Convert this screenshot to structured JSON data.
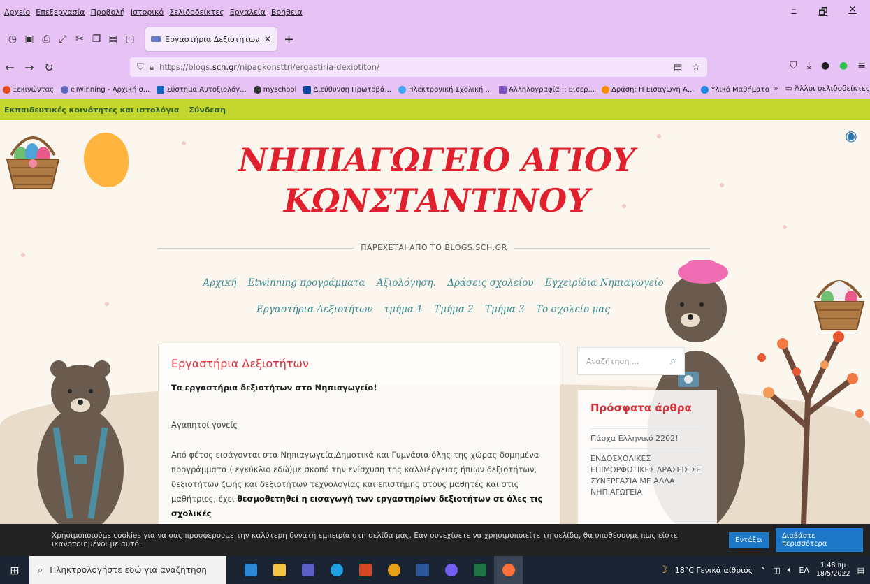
{
  "menu": [
    "Αρχείο",
    "Επεξεργασία",
    "Προβολή",
    "Ιστορικό",
    "Σελιδοδείκτες",
    "Εργαλεία",
    "Βοήθεια"
  ],
  "window_controls": {
    "minimize": "–",
    "restore": "🗗",
    "close": "✕"
  },
  "tab": {
    "title": "Εργαστήρια Δεξιοτήτων | ΝΗΠ",
    "close": "✕",
    "new_tab": "+"
  },
  "url": {
    "prefix": "https://blogs.",
    "host": "sch.gr",
    "path": "/nipagkonsttri/ergastiria-dexiotiton/"
  },
  "bookmarks": [
    {
      "label": "Ξεκινώντας",
      "color": "#e8491d"
    },
    {
      "label": "eTwinning - Αρχική σ...",
      "color": "#5c6bc0"
    },
    {
      "label": "Σύστημα Αυτοξιολόγ...",
      "color": "#1565c0"
    },
    {
      "label": "myschool",
      "color": "#333333"
    },
    {
      "label": "Διεύθυνση Πρωτοβά...",
      "color": "#0d47a1"
    },
    {
      "label": "Ηλεκτρονική Σχολική ...",
      "color": "#42a5f5"
    },
    {
      "label": "Αλληλογραφία :: Εισερ...",
      "color": "#7e57c2"
    },
    {
      "label": "Δράση: Η Εισαγωγή Α...",
      "color": "#fb8c00"
    },
    {
      "label": "Υλικό Μαθήματος | C...",
      "color": "#1e88e5"
    }
  ],
  "bookmarks_more": "»",
  "bookmarks_other": "Άλλοι σελιδοδείκτες",
  "adminbar": [
    "Εκπαιδευτικές κοινότητες και ιστολόγια",
    "Σύνδεση"
  ],
  "site": {
    "title_line1": "ΝΗΠΙΑΓΩΓΕΙΟ ΑΓΙΟΥ",
    "title_line2": "ΚΩΝΣΤΑΝΤΙΝΟΥ",
    "tagline": "ΠΑΡΕΧΕΤΑΙ ΑΠΟ ΤΟ BLOGS.SCH.GR"
  },
  "nav_row1": [
    "Αρχική",
    "Etwinning προγράμματα",
    "Αξιολόγηση.",
    "Δράσεις σχολείου",
    "Εγχειρίδια Νηπιαγωγείο"
  ],
  "nav_row2": [
    "Εργαστήρια Δεξιοτήτων",
    "τμήμα 1",
    "Τμήμα 2",
    "Τμήμα 3",
    "Το σχολείο μας"
  ],
  "entry": {
    "title": "Εργαστήρια Δεξιοτήτων",
    "lead": "Τα εργαστήρια δεξιοτήτων στο Νηπιαγωγείο!",
    "greeting": "Αγαπητοί γονείς",
    "body": "Από φέτος εισάγονται στα Νηπιαγωγεία,Δημοτικά και Γυμνάσια όλης της χώρας δομημένα προγράμματα  ( εγκύκλιο εδώ)με σκοπό την ενίσχυση της καλλιέργειας ήπιων δεξιοτήτων, δεξιοτήτων ζωής και δεξιοτήτων τεχνολογίας και επιστήμης στους μαθητές και στις μαθήτριες, έχει ",
    "body_bold": "θεσμοθετηθεί η εισαγωγή  των εργαστηρίων δεξιοτήτων  σε όλες τις σχολικές"
  },
  "search": {
    "placeholder": "Αναζήτηση ..."
  },
  "recent": {
    "heading": "Πρόσφατα άρθρα",
    "posts": [
      "Πάσχα Ελληνικό 2202!",
      "ΕΝΔΟΣΧΟΛΙΚΕΣ ΕΠΙΜΟΡΦΩΤΙΚΕΣ ΔΡΑΣΕΙΣ ΣΕ ΣΥΝΕΡΓΑΣΙΑ ΜΕ ΑΛΛΑ ΝΗΠΙΑΓΩΓΕΙΑ"
    ]
  },
  "cookie": {
    "text": "Χρησιμοποιούμε cookies για να σας προσφέρουμε την καλύτερη δυνατή εμπειρία στη σελίδα μας. Εάν συνεχίσετε να χρησιμοποιείτε τη σελίδα, θα υποθέσουμε πως είστε ικανοποιημένοι με αυτό.",
    "accept": "Εντάξει",
    "more": "Διαβάστε περισσότερα"
  },
  "taskbar": {
    "search_placeholder": "Πληκτρολογήστε εδώ για αναζήτηση",
    "weather": "18°C  Γενικά αίθριος",
    "lang": "ΕΛ",
    "time": "1:48 πμ",
    "date": "18/5/2022",
    "apps": [
      {
        "name": "mail",
        "color": "#2b88d8"
      },
      {
        "name": "explorer",
        "color": "#f4c542"
      },
      {
        "name": "teams",
        "color": "#5b5fc7"
      },
      {
        "name": "edge",
        "color": "#1fa0e0"
      },
      {
        "name": "powerpoint",
        "color": "#d24726"
      },
      {
        "name": "chrome",
        "color": "#e8a21a"
      },
      {
        "name": "word",
        "color": "#2b579a"
      },
      {
        "name": "viber",
        "color": "#7360f2"
      },
      {
        "name": "excel",
        "color": "#217346"
      },
      {
        "name": "firefox",
        "color": "#ff7139"
      }
    ]
  }
}
